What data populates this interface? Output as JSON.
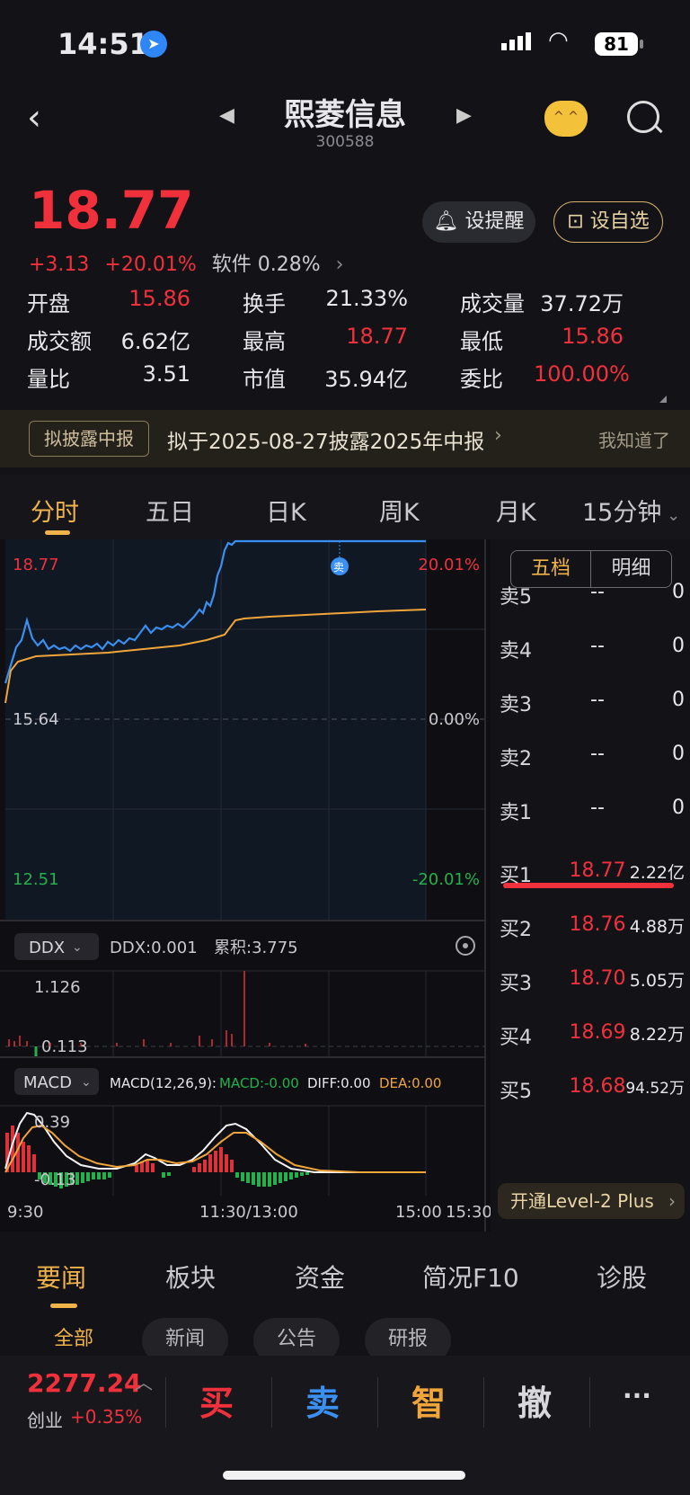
{
  "status": {
    "time": "14:51",
    "battery": "81"
  },
  "nav": {
    "title": "熙菱信息",
    "code": "300588"
  },
  "quote": {
    "price": "18.77",
    "change": "+3.13",
    "change_pct": "+20.01%",
    "sector": "软件 0.28%",
    "alert_label": "设提醒",
    "watch_label": "设自选"
  },
  "stats": [
    [
      {
        "k": "开盘",
        "v": "15.86",
        "c": "red"
      },
      {
        "k": "换手",
        "v": "21.33%",
        "c": ""
      },
      {
        "k": "成交量",
        "v": "37.72万",
        "c": ""
      }
    ],
    [
      {
        "k": "成交额",
        "v": "6.62亿",
        "c": ""
      },
      {
        "k": "最高",
        "v": "18.77",
        "c": "red"
      },
      {
        "k": "最低",
        "v": "15.86",
        "c": "red"
      }
    ],
    [
      {
        "k": "量比",
        "v": "3.51",
        "c": ""
      },
      {
        "k": "市值",
        "v": "35.94亿",
        "c": ""
      },
      {
        "k": "委比",
        "v": "100.00%",
        "c": "red"
      }
    ]
  ],
  "banner": {
    "tag": "拟披露中报",
    "text": "拟于2025-08-27披露2025年中报",
    "dismiss": "我知道了"
  },
  "tabs": [
    "分时",
    "五日",
    "日K",
    "周K",
    "月K",
    "15分钟"
  ],
  "chart": {
    "price_high": "18.77",
    "price_mid": "15.64",
    "price_low": "12.51",
    "pct_high": "20.01%",
    "pct_mid": "0.00%",
    "pct_low": "-20.01%",
    "sell_marker": "卖",
    "ddx_selector": "DDX",
    "ddx_value": "DDX:0.001",
    "ddx_cum": "累积:3.775",
    "ddx_top": "1.126",
    "ddx_bottom": "0.113",
    "macd_selector": "MACD",
    "macd_params": "MACD(12,26,9):",
    "macd_value": "MACD:-0.00",
    "diff_value": "DIFF:0.00",
    "dea_value": "DEA:0.00",
    "macd_top": "0.39",
    "macd_bottom": "-0.13",
    "times": [
      "9:30",
      "11:30/13:00",
      "15:00",
      "15:30"
    ]
  },
  "orderbook": {
    "tabs": [
      "五档",
      "明细"
    ],
    "sells": [
      {
        "label": "卖5",
        "price": "--",
        "qty": "0"
      },
      {
        "label": "卖4",
        "price": "--",
        "qty": "0"
      },
      {
        "label": "卖3",
        "price": "--",
        "qty": "0"
      },
      {
        "label": "卖2",
        "price": "--",
        "qty": "0"
      },
      {
        "label": "卖1",
        "price": "--",
        "qty": "0"
      }
    ],
    "buys": [
      {
        "label": "买1",
        "price": "18.77",
        "qty": "2.22亿"
      },
      {
        "label": "买2",
        "price": "18.76",
        "qty": "4.88万"
      },
      {
        "label": "买3",
        "price": "18.70",
        "qty": "5.05万"
      },
      {
        "label": "买4",
        "price": "18.69",
        "qty": "8.22万"
      },
      {
        "label": "买5",
        "price": "18.68",
        "qty": "94.52万"
      }
    ],
    "level2": "开通Level-2 Plus"
  },
  "news_tabs": [
    "要闻",
    "板块",
    "资金",
    "简况F10",
    "诊股"
  ],
  "news_filters": [
    "全部",
    "新闻",
    "公告",
    "研报"
  ],
  "bottom": {
    "index_value": "2277.24",
    "index_name": "创业",
    "index_pct": "+0.35%",
    "actions": [
      "买",
      "卖",
      "智",
      "撤",
      "···"
    ]
  },
  "colors": {
    "up": "#f0313c",
    "down": "#22b14c",
    "accent": "#f0b34a",
    "price_line": "#3b8ff0",
    "avg_line": "#f0a53a"
  }
}
